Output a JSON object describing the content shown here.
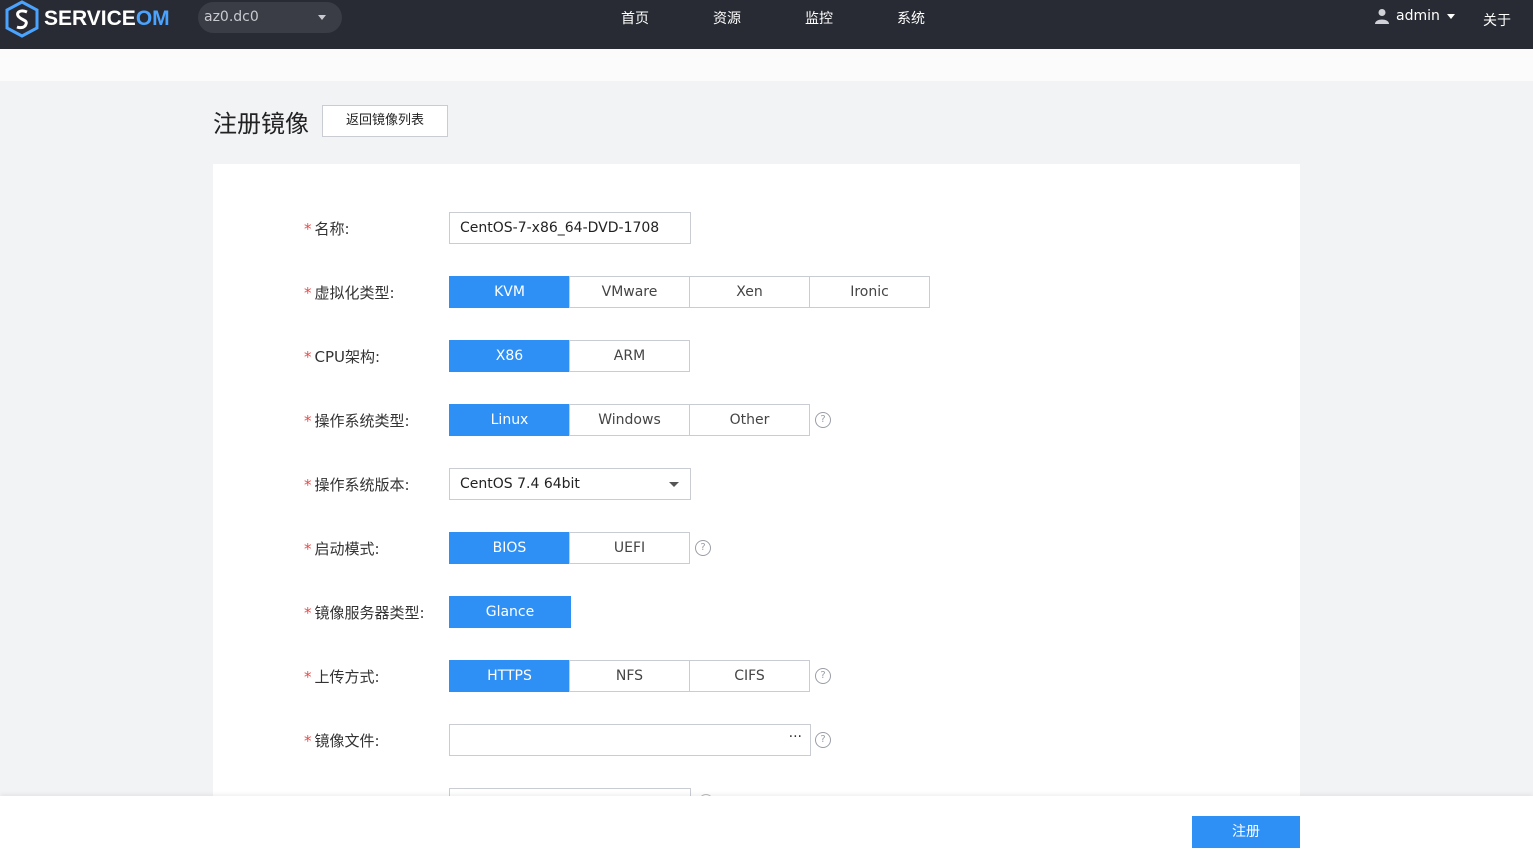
{
  "header": {
    "logo_text_prefix": "SERVICE",
    "logo_text_suffix": "OM",
    "region": "az0.dc0",
    "nav": [
      "首页",
      "资源",
      "监控",
      "系统"
    ],
    "user": "admin",
    "about": "关于"
  },
  "page": {
    "title": "注册镜像",
    "back_button": "返回镜像列表"
  },
  "form": {
    "required_mark": "*",
    "name": {
      "label": "名称:",
      "value": "CentOS-7-x86_64-DVD-1708"
    },
    "virt_type": {
      "label": "虚拟化类型:",
      "options": [
        "KVM",
        "VMware",
        "Xen",
        "Ironic"
      ],
      "selected": "KVM"
    },
    "cpu_arch": {
      "label": "CPU架构:",
      "options": [
        "X86",
        "ARM"
      ],
      "selected": "X86"
    },
    "os_type": {
      "label": "操作系统类型:",
      "options": [
        "Linux",
        "Windows",
        "Other"
      ],
      "selected": "Linux"
    },
    "os_version": {
      "label": "操作系统版本:",
      "value": "CentOS 7.4 64bit"
    },
    "boot_mode": {
      "label": "启动模式:",
      "options": [
        "BIOS",
        "UEFI"
      ],
      "selected": "BIOS"
    },
    "image_server": {
      "label": "镜像服务器类型:",
      "options": [
        "Glance"
      ],
      "selected": "Glance"
    },
    "upload_method": {
      "label": "上传方式:",
      "options": [
        "HTTPS",
        "NFS",
        "CIFS"
      ],
      "selected": "HTTPS"
    },
    "image_file": {
      "label": "镜像文件:",
      "value": "",
      "browse": "···"
    },
    "help_glyph": "?"
  },
  "footer": {
    "submit": "注册"
  },
  "colors": {
    "primary": "#2e8ff5",
    "topbar": "#282b33",
    "required": "#e84a4a"
  }
}
